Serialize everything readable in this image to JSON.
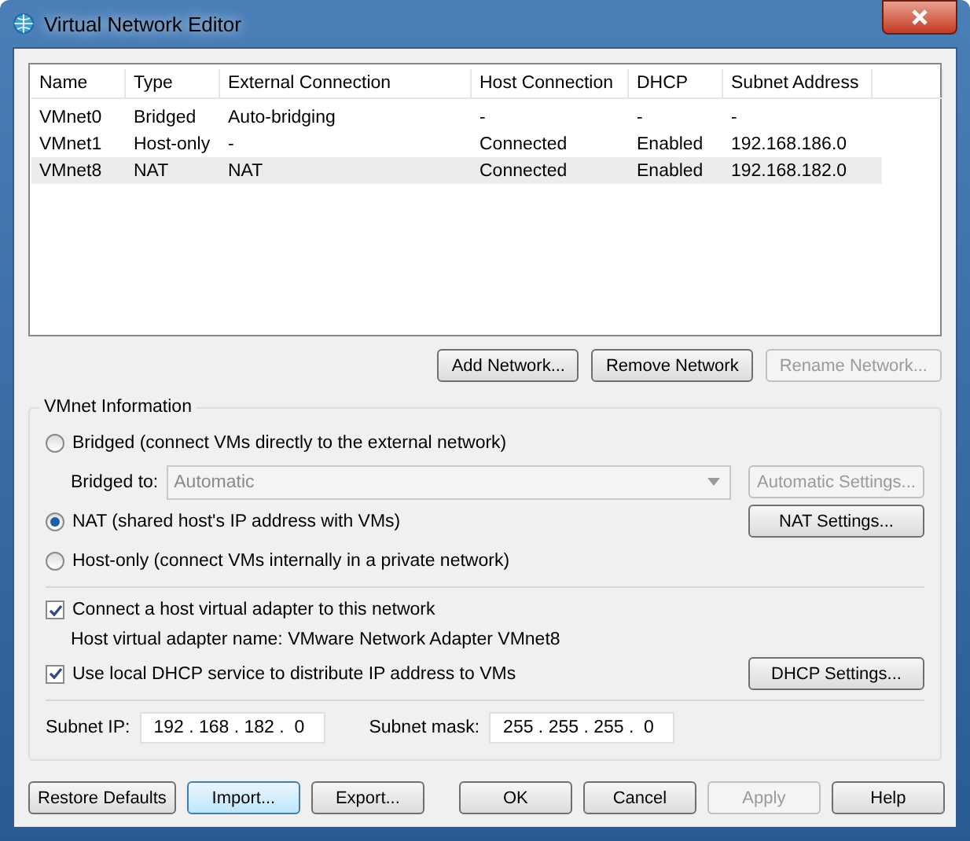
{
  "window": {
    "title": "Virtual Network Editor"
  },
  "table": {
    "columns": [
      "Name",
      "Type",
      "External Connection",
      "Host Connection",
      "DHCP",
      "Subnet Address"
    ],
    "rows": [
      {
        "cells": [
          "VMnet0",
          "Bridged",
          "Auto-bridging",
          "-",
          "-",
          "-"
        ],
        "selected": false
      },
      {
        "cells": [
          "VMnet1",
          "Host-only",
          "-",
          "Connected",
          "Enabled",
          "192.168.186.0"
        ],
        "selected": false
      },
      {
        "cells": [
          "VMnet8",
          "NAT",
          "NAT",
          "Connected",
          "Enabled",
          "192.168.182.0"
        ],
        "selected": true
      }
    ]
  },
  "network_buttons": [
    {
      "label": "Add Network...",
      "disabled": false
    },
    {
      "label": "Remove Network",
      "disabled": false
    },
    {
      "label": "Rename Network...",
      "disabled": true
    }
  ],
  "vmnet_information": {
    "title": "VMnet Information",
    "bridged": {
      "label": "Bridged (connect VMs directly to the external network)",
      "selected": false
    },
    "bridged_to": {
      "label": "Bridged to:",
      "value": "Automatic",
      "disabled": true,
      "button": {
        "label": "Automatic Settings...",
        "disabled": true
      }
    },
    "nat": {
      "label": "NAT (shared host's IP address with VMs)",
      "selected": true,
      "button": {
        "label": "NAT Settings...",
        "disabled": false
      }
    },
    "host_only": {
      "label": "Host-only (connect VMs internally in a private network)",
      "selected": false
    },
    "connect_adapter": {
      "label": "Connect a host virtual adapter to this network",
      "checked": true
    },
    "adapter_name": "Host virtual adapter name: VMware Network Adapter VMnet8",
    "use_dhcp": {
      "label": "Use local DHCP service to distribute IP address to VMs",
      "checked": true,
      "button": {
        "label": "DHCP Settings...",
        "disabled": false
      }
    },
    "subnet_ip": {
      "label": "Subnet IP:",
      "value": "192 . 168 . 182 .  0"
    },
    "subnet_mask": {
      "label": "Subnet mask:",
      "value": "255 . 255 . 255 .  0"
    }
  },
  "dialog_buttons": [
    {
      "label": "Restore Defaults",
      "disabled": false,
      "focused": false
    },
    {
      "label": "Import...",
      "disabled": false,
      "focused": true
    },
    {
      "label": "Export...",
      "disabled": false,
      "focused": false
    },
    {
      "label": "OK",
      "disabled": false,
      "focused": false
    },
    {
      "label": "Cancel",
      "disabled": false,
      "focused": false
    },
    {
      "label": "Apply",
      "disabled": true,
      "focused": false
    },
    {
      "label": "Help",
      "disabled": false,
      "focused": false
    }
  ]
}
